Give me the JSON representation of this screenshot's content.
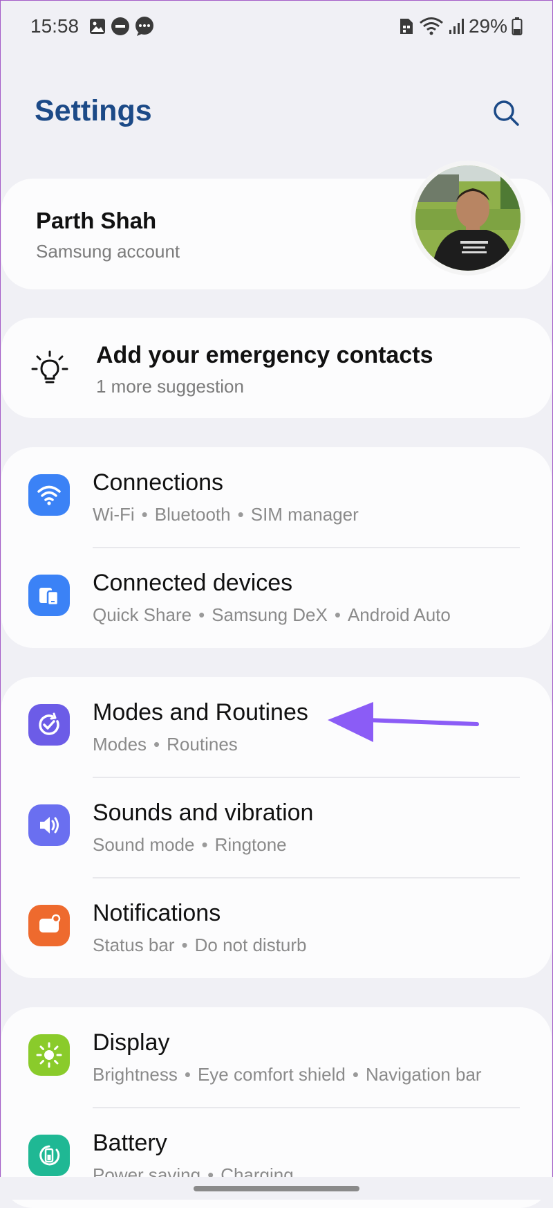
{
  "status_bar": {
    "time": "15:58",
    "battery_percent": "29%",
    "icons": [
      "image-icon",
      "do-not-disturb-icon",
      "more-notifications-icon",
      "sim-icon",
      "wifi-icon",
      "signal-icon",
      "battery-icon"
    ]
  },
  "header": {
    "title": "Settings",
    "search_icon": "search-icon"
  },
  "account": {
    "name": "Parth Shah",
    "subtitle": "Samsung account"
  },
  "suggestion": {
    "icon": "lightbulb-icon",
    "title": "Add your emergency contacts",
    "subtitle": "1 more suggestion"
  },
  "groups": [
    {
      "items": [
        {
          "title": "Connections",
          "subtitle_parts": [
            "Wi-Fi",
            "Bluetooth",
            "SIM manager"
          ],
          "icon": "wifi-icon",
          "color": "#3b82f6"
        },
        {
          "title": "Connected devices",
          "subtitle_parts": [
            "Quick Share",
            "Samsung DeX",
            "Android Auto"
          ],
          "icon": "devices-icon",
          "color": "#3b82f6"
        }
      ]
    },
    {
      "items": [
        {
          "title": "Modes and Routines",
          "subtitle_parts": [
            "Modes",
            "Routines"
          ],
          "icon": "check-circle-icon",
          "color": "#6c5ce7"
        },
        {
          "title": "Sounds and vibration",
          "subtitle_parts": [
            "Sound mode",
            "Ringtone"
          ],
          "icon": "volume-icon",
          "color": "#6a6ff0"
        },
        {
          "title": "Notifications",
          "subtitle_parts": [
            "Status bar",
            "Do not disturb"
          ],
          "icon": "notification-icon",
          "color": "#ee6a2e"
        }
      ]
    },
    {
      "items": [
        {
          "title": "Display",
          "subtitle_parts": [
            "Brightness",
            "Eye comfort shield",
            "Navigation bar"
          ],
          "icon": "sun-icon",
          "color": "#8acb2b"
        },
        {
          "title": "Battery",
          "subtitle_parts": [
            "Power saving",
            "Charging"
          ],
          "icon": "battery-icon",
          "color": "#1fb894"
        }
      ]
    }
  ],
  "sep_char": "•",
  "accent_colors": {
    "title": "#1c4a87",
    "annotation_arrow": "#8b5cf6"
  }
}
